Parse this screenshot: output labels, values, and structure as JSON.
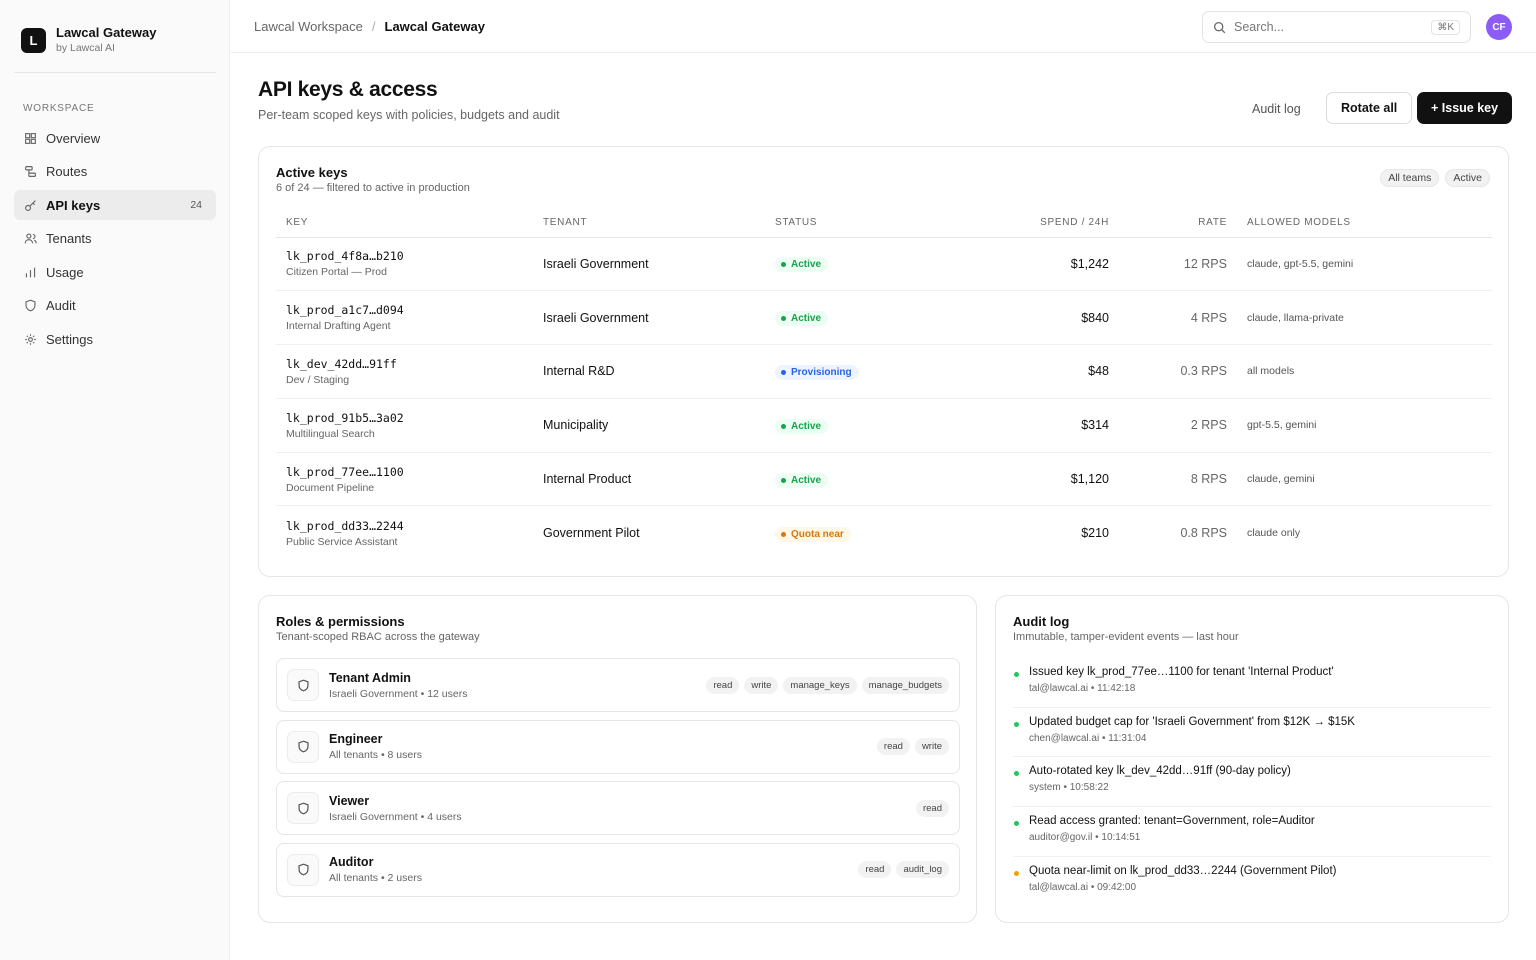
{
  "brand": {
    "logo_letter": "L",
    "name": "Lawcal Gateway",
    "sub": "by Lawcal AI"
  },
  "sidebar": {
    "section": "WORKSPACE",
    "items": [
      {
        "label": "Overview",
        "icon": "grid-icon",
        "count": ""
      },
      {
        "label": "Routes",
        "icon": "routes-icon",
        "count": ""
      },
      {
        "label": "API keys",
        "icon": "key-icon",
        "count": "24",
        "active": true
      },
      {
        "label": "Tenants",
        "icon": "users-icon",
        "count": ""
      },
      {
        "label": "Usage",
        "icon": "bar-chart-icon",
        "count": ""
      },
      {
        "label": "Audit",
        "icon": "shield-icon",
        "count": ""
      },
      {
        "label": "Settings",
        "icon": "gear-icon",
        "count": ""
      }
    ]
  },
  "topbar": {
    "breadcrumb": [
      "Lawcal Workspace",
      "Lawcal Gateway"
    ],
    "separator": "/",
    "search_placeholder": "Search...",
    "search_shortcut": "⌘K",
    "avatar_initials": "CF"
  },
  "header": {
    "title": "API keys & access",
    "subtitle": "Per-team scoped keys with policies, budgets and audit",
    "audit_log_label": "Audit log",
    "rotate_all_label": "Rotate all",
    "issue_key_label": "+ Issue key"
  },
  "keys": {
    "title": "Active keys",
    "subtitle": "6 of 24 — filtered to active in production",
    "filters": [
      "All teams",
      "Active"
    ],
    "columns": [
      "KEY",
      "TENANT",
      "STATUS",
      "SPEND / 24H",
      "RATE",
      "ALLOWED MODELS"
    ],
    "rows": [
      {
        "key": "lk_prod_4f8a…b210",
        "desc": "Citizen Portal — Prod",
        "tenant": "Israeli Government",
        "status": "Active",
        "status_color": "#16a34a",
        "status_bg": "#ecfdf3",
        "spend": "$1,242",
        "rate": "12 RPS",
        "models": "claude, gpt-5.5, gemini"
      },
      {
        "key": "lk_prod_a1c7…d094",
        "desc": "Internal Drafting Agent",
        "tenant": "Israeli Government",
        "status": "Active",
        "status_color": "#16a34a",
        "status_bg": "#ecfdf3",
        "spend": "$840",
        "rate": "4 RPS",
        "models": "claude, llama-private"
      },
      {
        "key": "lk_dev_42dd…91ff",
        "desc": "Dev / Staging",
        "tenant": "Internal R&D",
        "status": "Provisioning",
        "status_color": "#2563eb",
        "status_bg": "#eef4ff",
        "spend": "$48",
        "rate": "0.3 RPS",
        "models": "all models"
      },
      {
        "key": "lk_prod_91b5…3a02",
        "desc": "Multilingual Search",
        "tenant": "Municipality",
        "status": "Active",
        "status_color": "#16a34a",
        "status_bg": "#ecfdf3",
        "spend": "$314",
        "rate": "2 RPS",
        "models": "gpt-5.5, gemini"
      },
      {
        "key": "lk_prod_77ee…1100",
        "desc": "Document Pipeline",
        "tenant": "Internal Product",
        "status": "Active",
        "status_color": "#16a34a",
        "status_bg": "#ecfdf3",
        "spend": "$1,120",
        "rate": "8 RPS",
        "models": "claude, gemini"
      },
      {
        "key": "lk_prod_dd33…2244",
        "desc": "Public Service Assistant",
        "tenant": "Government Pilot",
        "status": "Quota near",
        "status_color": "#d97706",
        "status_bg": "#fff7e8",
        "spend": "$210",
        "rate": "0.8 RPS",
        "models": "claude only"
      }
    ]
  },
  "roles": {
    "title": "Roles & permissions",
    "subtitle": "Tenant-scoped RBAC across the gateway",
    "items": [
      {
        "name": "Tenant Admin",
        "meta": "Israeli Government • 12 users",
        "perms": [
          "read",
          "write",
          "manage_keys",
          "manage_budgets"
        ]
      },
      {
        "name": "Engineer",
        "meta": "All tenants • 8 users",
        "perms": [
          "read",
          "write"
        ]
      },
      {
        "name": "Viewer",
        "meta": "Israeli Government • 4 users",
        "perms": [
          "read"
        ]
      },
      {
        "name": "Auditor",
        "meta": "All tenants • 2 users",
        "perms": [
          "read",
          "audit_log"
        ]
      }
    ]
  },
  "audit": {
    "title": "Audit log",
    "subtitle": "Immutable, tamper-evident events — last hour",
    "events": [
      {
        "text": "Issued key lk_prod_77ee…1100 for tenant 'Internal Product'",
        "meta": "tal@lawcal.ai • 11:42:18",
        "color": "#22c55e"
      },
      {
        "text": "Updated budget cap for 'Israeli Government' from $12K → $15K",
        "meta": "chen@lawcal.ai • 11:31:04",
        "color": "#22c55e"
      },
      {
        "text": "Auto-rotated key lk_dev_42dd…91ff (90-day policy)",
        "meta": "system • 10:58:22",
        "color": "#22c55e"
      },
      {
        "text": "Read access granted: tenant=Government, role=Auditor",
        "meta": "auditor@gov.il • 10:14:51",
        "color": "#22c55e"
      },
      {
        "text": "Quota near-limit on lk_prod_dd33…2244 (Government Pilot)",
        "meta": "tal@lawcal.ai • 09:42:00",
        "color": "#f59e0b"
      }
    ]
  }
}
